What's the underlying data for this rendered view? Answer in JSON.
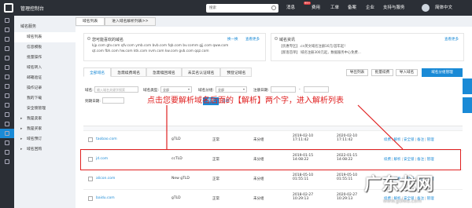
{
  "topbar": {
    "title": "管理控制台",
    "search_placeholder": "搜索",
    "nav": [
      "消息",
      "费用",
      "工单",
      "备案",
      "企业",
      "支持与服务"
    ],
    "badge": "99+",
    "language": "简体中文"
  },
  "sidebar": {
    "heading": "域名服务",
    "items": [
      {
        "label": "域名列表",
        "arrow": false
      },
      {
        "label": "信息模板",
        "arrow": false
      },
      {
        "label": "批量操作",
        "arrow": false
      },
      {
        "label": "域名转入",
        "arrow": false
      },
      {
        "label": "邮箱验证",
        "arrow": false
      },
      {
        "label": "操作记录",
        "arrow": false
      },
      {
        "label": "我的下载",
        "arrow": false
      },
      {
        "label": "安全锁管理",
        "arrow": false
      },
      {
        "label": "我是卖家",
        "arrow": true
      },
      {
        "label": "我是买家",
        "arrow": true
      },
      {
        "label": "域名预订",
        "arrow": true
      },
      {
        "label": "域名回购",
        "arrow": true
      }
    ]
  },
  "tabs": [
    "域名列表",
    "进入域名解析列表>>"
  ],
  "promo": {
    "title": "您可能喜欢的域名",
    "swap": "换一换",
    "more": "查看更多",
    "lines": [
      "kjp.com  gtv.com  qfv.com  ymb.com  bvb.com  fqb.com  bv.comm  gjj.com  qww.com",
      "qt.com  fbh.com  hw.com  ktk.com  nvm.com  kw.com  gvb.com  qqz.com"
    ]
  },
  "news": {
    "title": "域名资讯",
    "more": "查看更多",
    "lines": [
      "【优惠专区】.cn英文域名注册16元/首年起！",
      "【新客首单】 域名注册300元起，数据服务中心免费..."
    ]
  },
  "actions": {
    "export": "导出列表",
    "batch_renew": "批量续费",
    "import": "导入域名",
    "manage": "域名分组管理"
  },
  "filter_tabs": [
    "全部域名",
    "急需续费域名",
    "急需赎回域名",
    "未实名认证域名",
    "预登记域名"
  ],
  "filters": {
    "domain_label": "域名:",
    "domain_placeholder": "输入域名关键字搜索",
    "type_label": "域名类型:",
    "type_value": "全部",
    "group_label": "域名分组:",
    "group_value": "全部",
    "reg_label": "注册日期:",
    "reg_sep": "-",
    "expire_label": "到期日期:",
    "search_btn": "搜索",
    "expand": "高级"
  },
  "annotation": "点击您要解析域名后面的【解析】两个字，进入解析列表",
  "table": {
    "headers": [
      "域名",
      "域名类型",
      "域名状态",
      "域名分组",
      "注册日期",
      "到期日期",
      "操作"
    ],
    "header_sub": [
      "▼",
      "▼",
      "▼"
    ],
    "rows": [
      {
        "domain": "taobao.com",
        "type": "gTLD",
        "status": "正常",
        "group": "未分组",
        "reg": "2019-02-10 17:11:42",
        "exp": "2020-02-10 17:11:42",
        "ops": [
          "续费",
          "解析",
          "安全锁",
          "备注",
          "管理"
        ]
      },
      {
        "domain": "jd.com",
        "type": "ccTLD",
        "status": "正常",
        "group": "未分组",
        "reg": "2019-01-15 14:08:22",
        "exp": "2022-01-15 14:08:22",
        "ops": [
          "续费",
          "解析",
          "安全锁",
          "备注",
          "管理"
        ]
      },
      {
        "domain": "alicon.com",
        "type": "New gTLD",
        "status": "正常",
        "group": "未分组",
        "reg": "2018-05-10 01:55:11",
        "exp": "2019-05-10 01:55:11",
        "ops": [
          "续费",
          "解析",
          "安全锁",
          "备注",
          "管理"
        ]
      },
      {
        "domain": "baidu.com",
        "type": "gTLD",
        "status": "正常",
        "group": "未分组",
        "reg": "2018-02-27 10:29:13",
        "exp": "2020-02-27 10:29:13",
        "ops": [
          "续费",
          "解析",
          "安全锁",
          "备注",
          "管理"
        ]
      }
    ]
  },
  "watermark": {
    "text": "广东龙网",
    "url": "www.gdlwa.com"
  },
  "colors": {
    "accent": "#1a8ad6",
    "annotation": "#e02020",
    "topbar": "#2b2f36"
  }
}
